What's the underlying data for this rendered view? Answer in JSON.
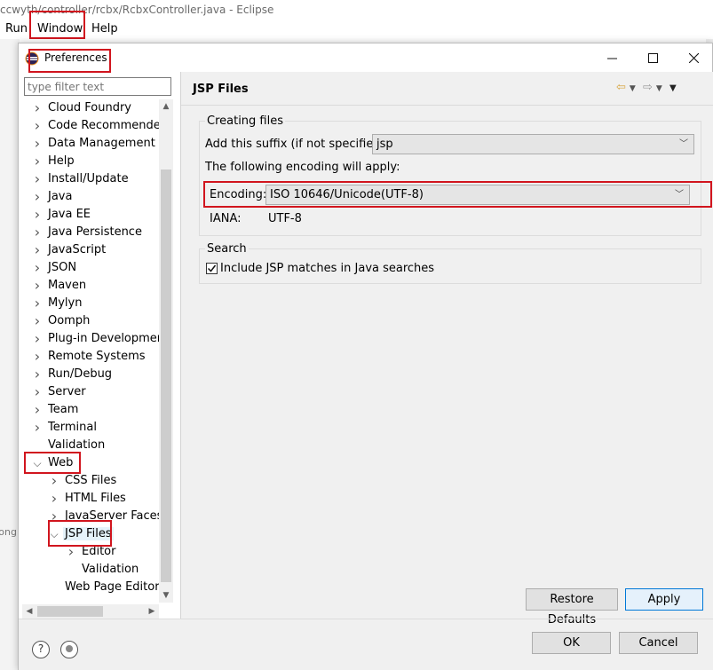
{
  "eclipse": {
    "title": "ccwyth/controller/rcbx/RcbxController.java - Eclipse",
    "menus": [
      "Run",
      "Window",
      "Help"
    ],
    "left_fragment": "rong"
  },
  "dialog": {
    "title": "Preferences",
    "filter_placeholder": "type filter text",
    "tree": [
      {
        "label": "Cloud Foundry",
        "level": 0,
        "arrow": ">"
      },
      {
        "label": "Code Recommenders",
        "level": 0,
        "arrow": ">"
      },
      {
        "label": "Data Management",
        "level": 0,
        "arrow": ">"
      },
      {
        "label": "Help",
        "level": 0,
        "arrow": ">"
      },
      {
        "label": "Install/Update",
        "level": 0,
        "arrow": ">"
      },
      {
        "label": "Java",
        "level": 0,
        "arrow": ">"
      },
      {
        "label": "Java EE",
        "level": 0,
        "arrow": ">"
      },
      {
        "label": "Java Persistence",
        "level": 0,
        "arrow": ">"
      },
      {
        "label": "JavaScript",
        "level": 0,
        "arrow": ">"
      },
      {
        "label": "JSON",
        "level": 0,
        "arrow": ">"
      },
      {
        "label": "Maven",
        "level": 0,
        "arrow": ">"
      },
      {
        "label": "Mylyn",
        "level": 0,
        "arrow": ">"
      },
      {
        "label": "Oomph",
        "level": 0,
        "arrow": ">"
      },
      {
        "label": "Plug-in Development",
        "level": 0,
        "arrow": ">"
      },
      {
        "label": "Remote Systems",
        "level": 0,
        "arrow": ">"
      },
      {
        "label": "Run/Debug",
        "level": 0,
        "arrow": ">"
      },
      {
        "label": "Server",
        "level": 0,
        "arrow": ">"
      },
      {
        "label": "Team",
        "level": 0,
        "arrow": ">"
      },
      {
        "label": "Terminal",
        "level": 0,
        "arrow": ">"
      },
      {
        "label": "Validation",
        "level": 0,
        "arrow": ""
      },
      {
        "label": "Web",
        "level": 0,
        "arrow": "v"
      },
      {
        "label": "CSS Files",
        "level": 1,
        "arrow": ">"
      },
      {
        "label": "HTML Files",
        "level": 1,
        "arrow": ">"
      },
      {
        "label": "JavaServer Faces T",
        "level": 1,
        "arrow": ">"
      },
      {
        "label": "JSP Files",
        "level": 1,
        "arrow": "v",
        "selected": true
      },
      {
        "label": "Editor",
        "level": 2,
        "arrow": ">"
      },
      {
        "label": "Validation",
        "level": 2,
        "arrow": ""
      },
      {
        "label": "Web Page Editor",
        "level": 1,
        "arrow": ""
      }
    ],
    "page_title": "JSP Files",
    "creating_files": {
      "group_label": "Creating files",
      "suffix_label": "Add this suffix (if not specified):",
      "suffix_value": "jsp",
      "encoding_note": "The following encoding will apply:",
      "encoding_label": "Encoding:",
      "encoding_value": "ISO 10646/Unicode(UTF-8)",
      "iana_label": "IANA:",
      "iana_value": "UTF-8"
    },
    "search": {
      "group_label": "Search",
      "checkbox_label": "Include JSP matches in Java searches",
      "checked": true
    },
    "buttons": {
      "restore_defaults": "Restore Defaults",
      "apply": "Apply",
      "ok": "OK",
      "cancel": "Cancel"
    },
    "highlight_color": "#d1151e"
  }
}
